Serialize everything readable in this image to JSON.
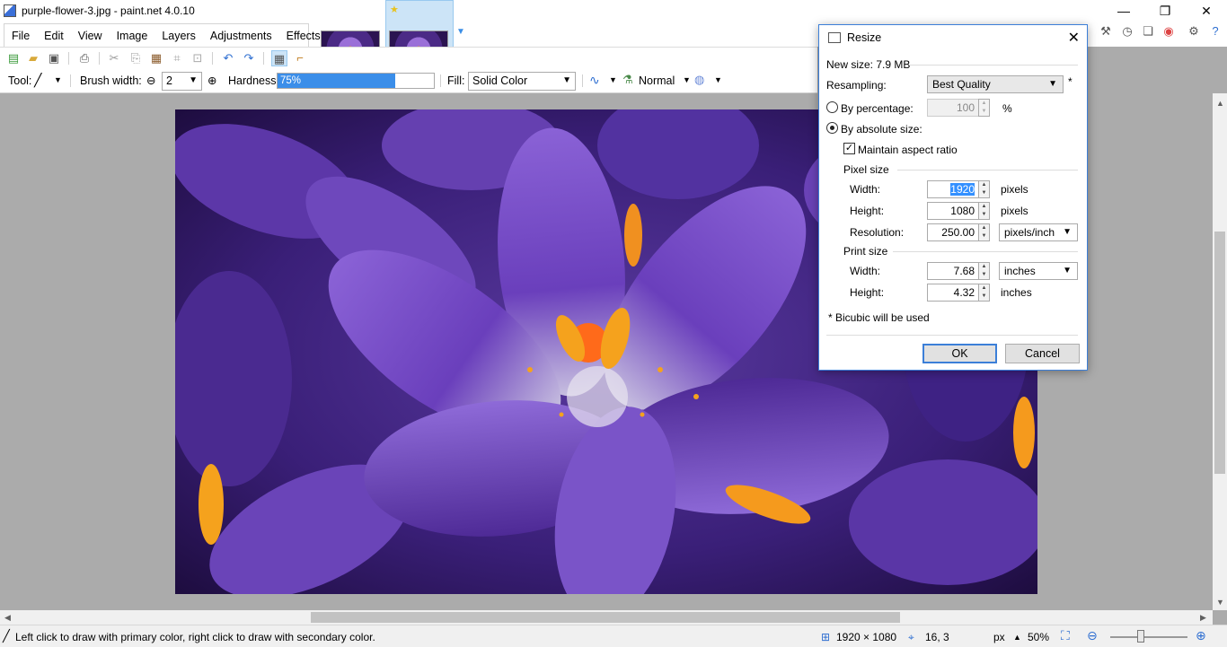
{
  "window": {
    "title": "purple-flower-3.jpg - paint.net 4.0.10",
    "minimize": "—",
    "restore": "❐",
    "close": "✕"
  },
  "menu": {
    "items": [
      "File",
      "Edit",
      "View",
      "Image",
      "Layers",
      "Adjustments",
      "Effects"
    ]
  },
  "toolbar": {
    "tool_label": "Tool:",
    "brush_width_label": "Brush width:",
    "brush_width_value": "2",
    "hardness_label": "Hardness:",
    "hardness_value": "75%",
    "hardness_fraction": 0.75,
    "fill_label": "Fill:",
    "fill_value": "Solid Color",
    "blend_mode": "Normal"
  },
  "dialog": {
    "title": "Resize",
    "new_size": "New size: 7.9 MB",
    "resampling_label": "Resampling:",
    "resampling_value": "Best Quality",
    "resampling_asterisk": "*",
    "by_percentage_label": "By percentage:",
    "percentage_value": "100",
    "percent_sign": "%",
    "by_absolute_label": "By absolute size:",
    "maintain_aspect_label": "Maintain aspect ratio",
    "pixel_size_label": "Pixel size",
    "width_label": "Width:",
    "width_value": "1920",
    "pixels_label": "pixels",
    "height_label": "Height:",
    "height_value": "1080",
    "resolution_label": "Resolution:",
    "resolution_value": "250.00",
    "resolution_unit": "pixels/inch",
    "print_size_label": "Print size",
    "print_width_value": "7.68",
    "print_unit": "inches",
    "print_height_value": "4.32",
    "print_height_unit": "inches",
    "bicubic_note": "* Bicubic will be used",
    "ok_label": "OK",
    "cancel_label": "Cancel"
  },
  "status": {
    "hint": "Left click to draw with primary color, right click to draw with secondary color.",
    "image_size": "1920 × 1080",
    "cursor_pos": "16, 3",
    "units": "px",
    "zoom": "50%"
  },
  "colors": {
    "accent": "#3b8ee9",
    "selection": "#cce4f7",
    "dialog_border": "#3c7fd8"
  }
}
